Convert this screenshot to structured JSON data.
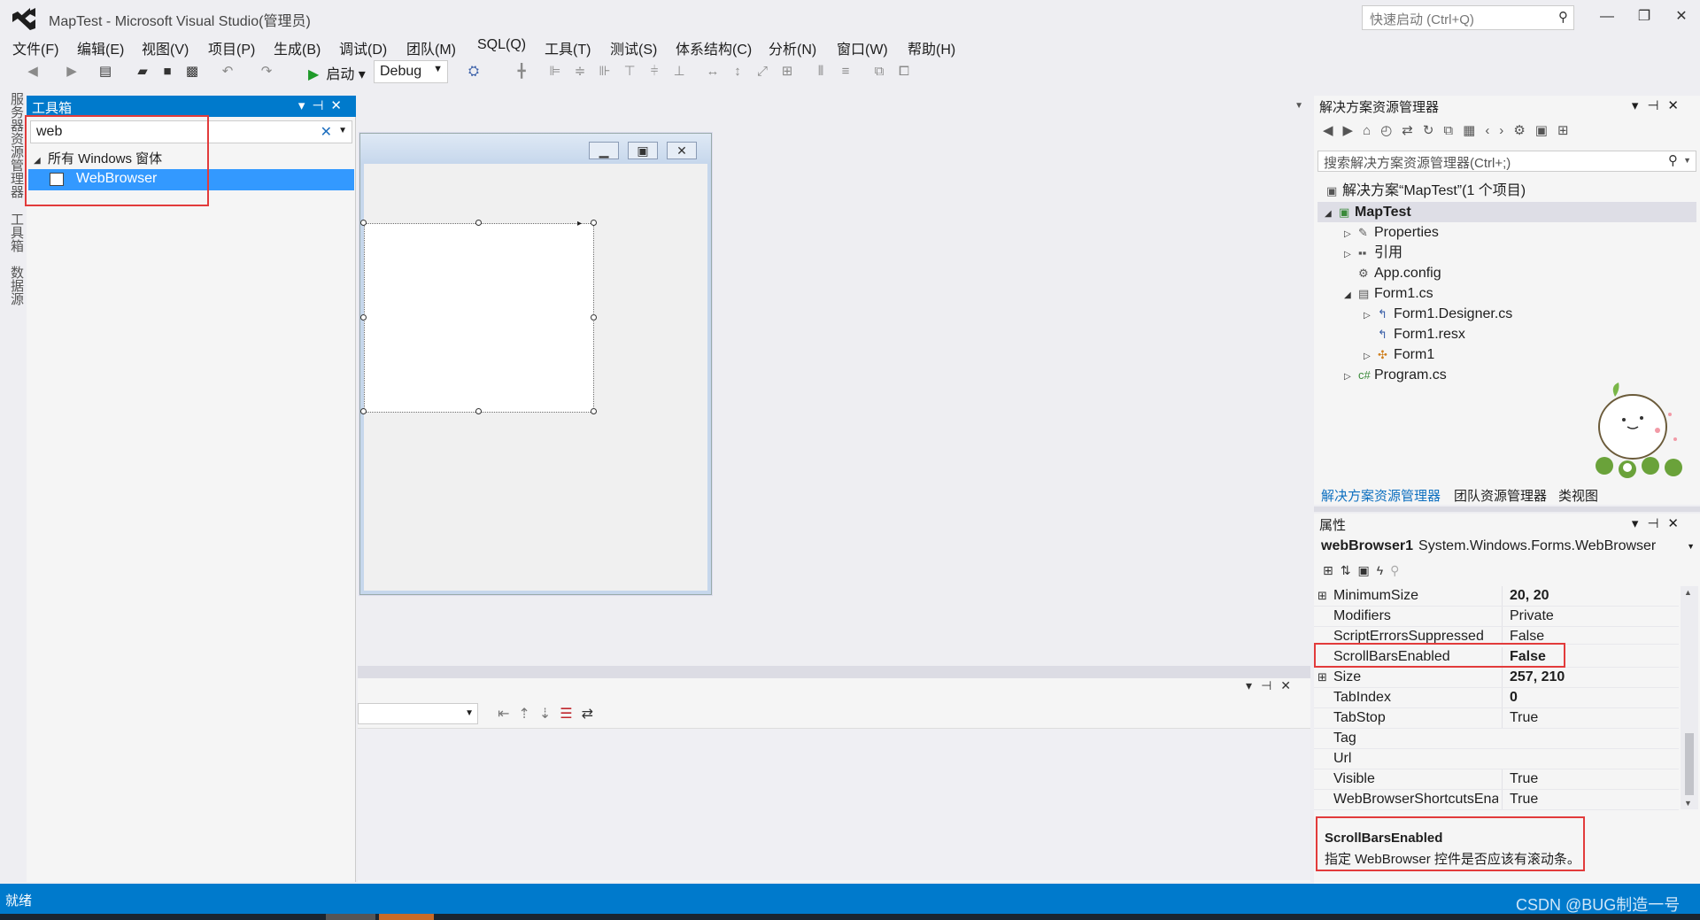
{
  "window": {
    "title": "MapTest - Microsoft Visual Studio(管理员)",
    "quick_launch_placeholder": "快速启动 (Ctrl+Q)",
    "minimize_glyph": "—",
    "restore_glyph": "❐",
    "close_glyph": "✕"
  },
  "menu": [
    "文件(F)",
    "编辑(E)",
    "视图(V)",
    "项目(P)",
    "生成(B)",
    "调试(D)",
    "团队(M)",
    "SQL(Q)",
    "工具(T)",
    "测试(S)",
    "体系结构(C)",
    "分析(N)",
    "窗口(W)",
    "帮助(H)"
  ],
  "toolbar": {
    "start_label": "启动",
    "config_value": "Debug"
  },
  "side_tabs": [
    "服务器资源管理器",
    "工具箱",
    "数据源"
  ],
  "toolbox": {
    "title": "工具箱",
    "search_value": "web",
    "group_label": "所有 Windows 窗体",
    "item_label": "WebBrowser"
  },
  "solution_explorer": {
    "title": "解决方案资源管理器",
    "search_placeholder": "搜索解决方案资源管理器(Ctrl+;)",
    "solution_label": "解决方案“MapTest”(1 个项目)",
    "project_label": "MapTest",
    "nodes": [
      "Properties",
      "引用",
      "App.config",
      "Form1.cs",
      "Form1.Designer.cs",
      "Form1.resx",
      "Form1",
      "Program.cs"
    ],
    "tabs": [
      "解决方案资源管理器",
      "团队资源管理器",
      "类视图"
    ]
  },
  "properties": {
    "title": "属性",
    "object_name": "webBrowser1",
    "object_type": "System.Windows.Forms.WebBrowser",
    "rows": [
      {
        "name": "MinimumSize",
        "value": "20, 20"
      },
      {
        "name": "Modifiers",
        "value": "Private"
      },
      {
        "name": "ScriptErrorsSuppressed",
        "value": "False"
      },
      {
        "name": "ScrollBarsEnabled",
        "value": "False"
      },
      {
        "name": "Size",
        "value": "257, 210"
      },
      {
        "name": "TabIndex",
        "value": "0"
      },
      {
        "name": "TabStop",
        "value": "True"
      },
      {
        "name": "Tag",
        "value": ""
      },
      {
        "name": "Url",
        "value": ""
      },
      {
        "name": "Visible",
        "value": "True"
      },
      {
        "name": "WebBrowserShortcutsEnabled",
        "value": "True"
      }
    ],
    "desc_title": "ScrollBarsEnabled",
    "desc_text": "指定 WebBrowser 控件是否应该有滚动条。"
  },
  "status": {
    "text": "就绪",
    "watermark": "CSDN @BUG制造一号"
  },
  "colors": {
    "accent": "#007acc",
    "selection": "#3399ff",
    "highlight_border": "#e23b3b"
  }
}
